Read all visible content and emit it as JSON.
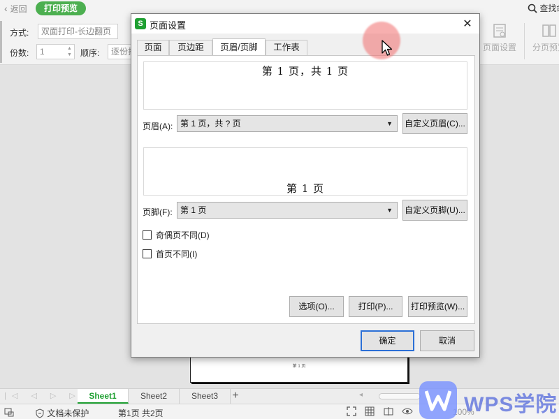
{
  "topbar": {
    "back_label": "返回",
    "mode_label": "打印预览",
    "find_label": "查找命"
  },
  "toolbar": {
    "method_label": "方式:",
    "method_value": "双面打印-长边翻页",
    "copies_label": "份数:",
    "copies_value": "1",
    "order_label": "顺序:",
    "order_value": "逐份打",
    "page_setup_label": "页面设置",
    "page_break_label": "分页预览"
  },
  "page_preview": {
    "footer_text": "第 1 页"
  },
  "sheets": {
    "tabs": [
      "Sheet1",
      "Sheet2",
      "Sheet3"
    ],
    "active_index": 0,
    "add_symbol": "+"
  },
  "status": {
    "protect_label": "文档未保护",
    "page_info": "第1页 共2页",
    "zoom": "100%"
  },
  "watermark": {
    "text": "WPS学院"
  },
  "dialog": {
    "title": "页面设置",
    "close_symbol": "✕",
    "tabs": [
      "页面",
      "页边距",
      "页眉/页脚",
      "工作表"
    ],
    "active_tab": 2,
    "header_preview": "第 1 页，共 1 页",
    "header_label": "页眉(A):",
    "header_value": "第 1 页，共 ? 页",
    "custom_header_button": "自定义页眉(C)...",
    "footer_preview": "第 1 页",
    "footer_label": "页脚(F):",
    "footer_value": "第 1 页",
    "custom_footer_button": "自定义页脚(U)...",
    "odd_even_label": "奇偶页不同(D)",
    "odd_even_checked": false,
    "first_page_label": "首页不同(I)",
    "first_page_checked": false,
    "options_button": "选项(O)...",
    "print_button": "打印(P)...",
    "print_preview_button": "打印预览(W)...",
    "ok_button": "确定",
    "cancel_button": "取消"
  },
  "colors": {
    "accent_green": "#1fa032",
    "pill_green": "#4caf50",
    "focus_blue": "#2b6fd6",
    "watermark_blue": "#7a92ff"
  }
}
